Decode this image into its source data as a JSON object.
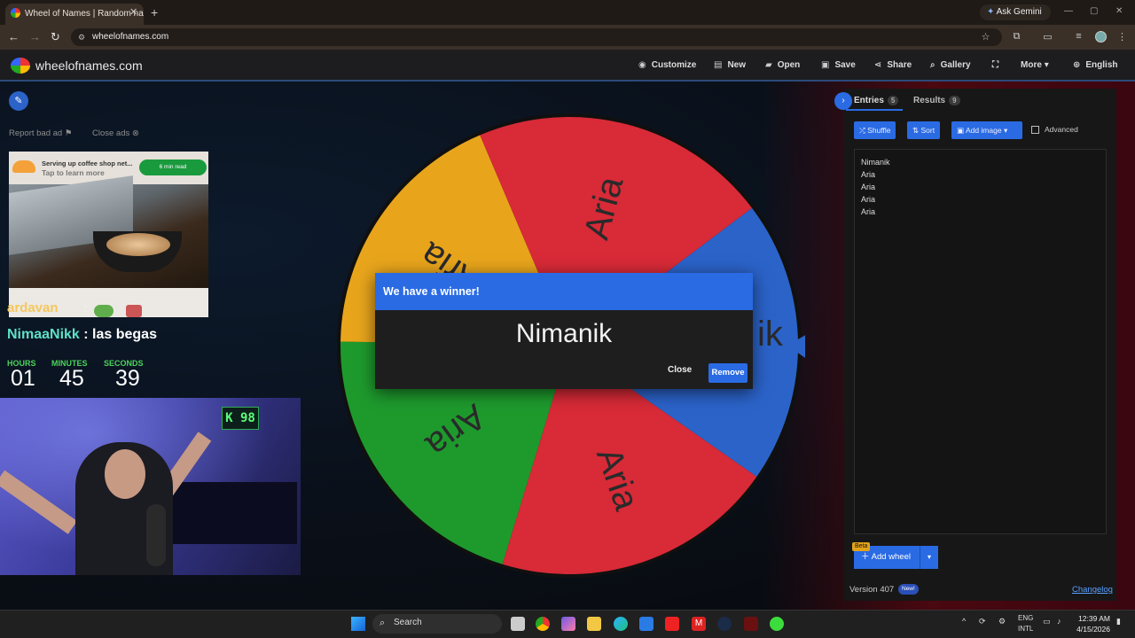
{
  "browser": {
    "tab_title": "Wheel of Names | Random name",
    "url": "wheelofnames.com",
    "gemini_label": "Ask Gemini"
  },
  "header": {
    "site_name": "wheelofnames.com",
    "nav": [
      "Customize",
      "New",
      "Open",
      "Save",
      "Share",
      "Gallery",
      "More",
      "English"
    ]
  },
  "ad": {
    "report_label": "Report bad ad",
    "close_label": "Close ads",
    "line1": "Serving up coffee shop net...",
    "line2": "Tap to learn more",
    "cta": "6 min read"
  },
  "overlay": {
    "chat1_user": "ardavan",
    "chat2_user": "NimaaNikk",
    "chat2_message": " : las begas",
    "timer": {
      "hours_label": "HOURS",
      "hours": "01",
      "minutes_label": "MINUTES",
      "minutes": "45",
      "seconds_label": "SECONDS",
      "seconds": "39"
    },
    "led_display": "K 98"
  },
  "wheel": {
    "segments": [
      {
        "label": "Aria",
        "color": "#d82a37"
      },
      {
        "label": "Nimanik",
        "color": "#2b63c9"
      },
      {
        "label": "Aria",
        "color": "#d82a37"
      },
      {
        "label": "Aria",
        "color": "#1e9a2d"
      },
      {
        "label": "Aria",
        "color": "#e8a51c"
      }
    ],
    "visible_partial_label": "ik",
    "pointer_color": "#2b63c9"
  },
  "modal": {
    "title": "We have a winner!",
    "winner": "Nimanik",
    "close_label": "Close",
    "remove_label": "Remove"
  },
  "panel": {
    "tab_entries": "Entries",
    "entries_count": "5",
    "tab_results": "Results",
    "results_count": "9",
    "shuffle_label": "Shuffle",
    "sort_label": "Sort",
    "add_image_label": "Add image",
    "advanced_label": "Advanced",
    "entries": [
      "Nimanik",
      "Aria",
      "Aria",
      "Aria",
      "Aria"
    ],
    "beta_label": "Beta",
    "add_wheel_label": "Add wheel",
    "version": "Version 407",
    "new_badge": "New!",
    "changelog": "Changelog"
  },
  "taskbar": {
    "search_placeholder": "Search",
    "lang1": "ENG",
    "lang2": "INTL",
    "time": "12:39 AM",
    "date": "4/15/2026"
  }
}
